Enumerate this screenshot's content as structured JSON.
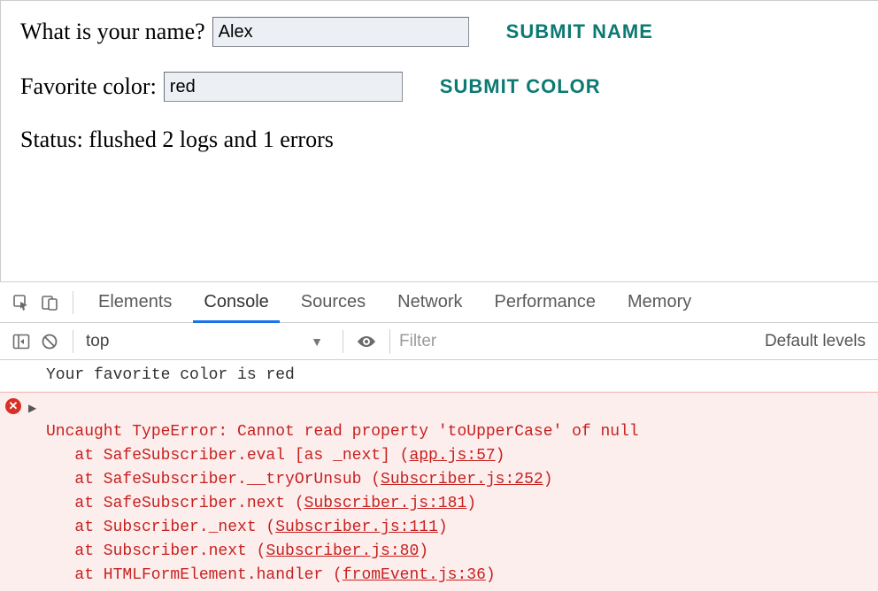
{
  "form": {
    "name_label": "What is your name?",
    "name_value": "Alex",
    "name_submit": "SUBMIT NAME",
    "color_label": "Favorite color:",
    "color_value": "red",
    "color_submit": "SUBMIT COLOR"
  },
  "status": {
    "prefix": "Status: ",
    "text": "flushed 2 logs and 1 errors"
  },
  "devtools": {
    "tabs": {
      "elements": "Elements",
      "console": "Console",
      "sources": "Sources",
      "network": "Network",
      "performance": "Performance",
      "memory": "Memory"
    },
    "active_tab": "console",
    "toolbar": {
      "context": "top",
      "filter_placeholder": "Filter",
      "levels": "Default levels"
    },
    "console": {
      "log1": "Your favorite color is red",
      "error": {
        "message": "Uncaught TypeError: Cannot read property 'toUpperCase' of null",
        "stack": [
          {
            "prefix": "at SafeSubscriber.eval [as _next] (",
            "src": "app.js:57",
            "suffix": ")"
          },
          {
            "prefix": "at SafeSubscriber.__tryOrUnsub (",
            "src": "Subscriber.js:252",
            "suffix": ")"
          },
          {
            "prefix": "at SafeSubscriber.next (",
            "src": "Subscriber.js:181",
            "suffix": ")"
          },
          {
            "prefix": "at Subscriber._next (",
            "src": "Subscriber.js:111",
            "suffix": ")"
          },
          {
            "prefix": "at Subscriber.next (",
            "src": "Subscriber.js:80",
            "suffix": ")"
          },
          {
            "prefix": "at HTMLFormElement.handler (",
            "src": "fromEvent.js:36",
            "suffix": ")"
          }
        ]
      }
    }
  }
}
